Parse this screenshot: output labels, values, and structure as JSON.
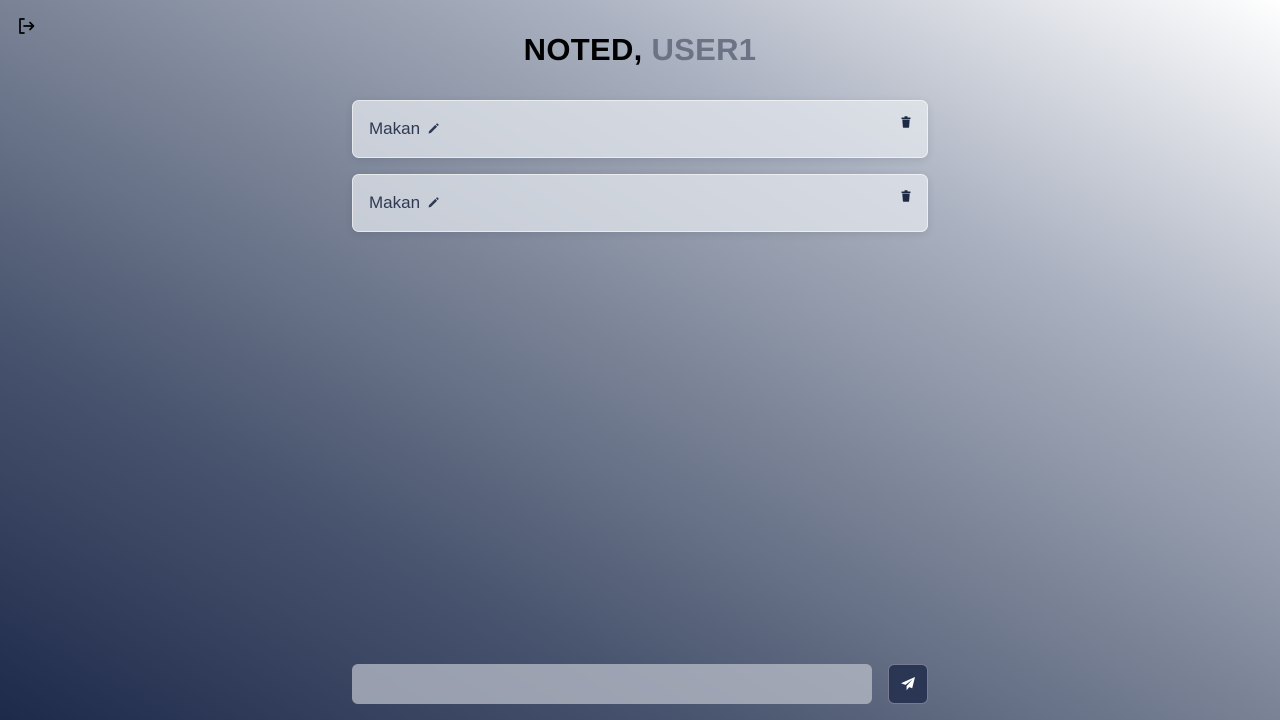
{
  "header": {
    "brand": "NOTED,",
    "username": "USER1"
  },
  "actions": {
    "logout_icon": "logout-icon",
    "send_icon": "paper-plane-icon"
  },
  "notes": [
    {
      "text": "Makan",
      "edit_icon": "pencil-icon",
      "delete_icon": "trash-icon"
    },
    {
      "text": "Makan",
      "edit_icon": "pencil-icon",
      "delete_icon": "trash-icon"
    }
  ],
  "composer": {
    "value": "",
    "placeholder": ""
  },
  "colors": {
    "note_text": "#2e3a52",
    "username": "#6b7385",
    "send_button": "#2b3654"
  }
}
